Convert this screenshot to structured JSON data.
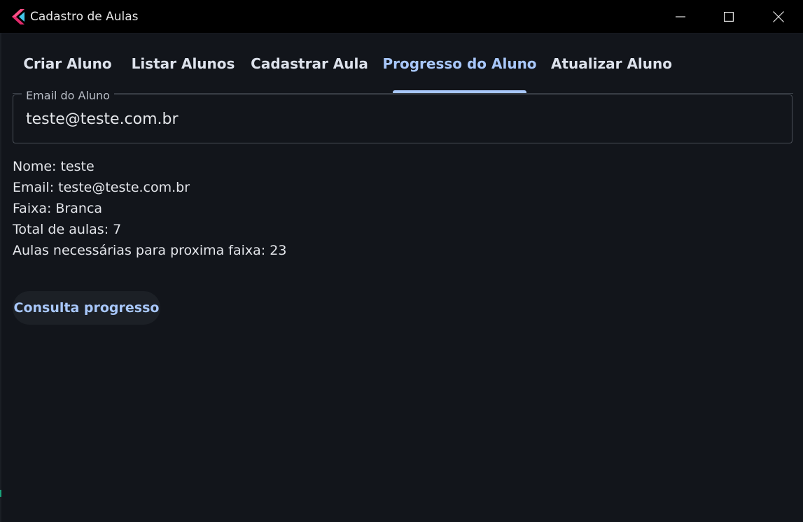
{
  "window": {
    "title": "Cadastro de Aulas",
    "app_icon": "flutter-icon",
    "controls": [
      "minimize-icon",
      "maximize-icon",
      "close-icon"
    ]
  },
  "tabs": [
    {
      "label": "Criar Aluno",
      "active": false
    },
    {
      "label": "Listar Alunos",
      "active": false
    },
    {
      "label": "Cadastrar Aula",
      "active": false
    },
    {
      "label": "Progresso do Aluno",
      "active": true
    },
    {
      "label": "Atualizar Aluno",
      "active": false
    }
  ],
  "email_field": {
    "label": "Email do Aluno",
    "value": "teste@teste.com.br"
  },
  "student_info": {
    "nome": "Nome: teste",
    "email": "Email: teste@teste.com.br",
    "faixa": "Faixa: Branca",
    "total_aulas": "Total de aulas: 7",
    "aulas_necessarias": "Aulas necessárias para proxima faixa: 23"
  },
  "actions": {
    "consult_label": "Consulta progresso"
  },
  "colors": {
    "accent": "#a8c7fa",
    "background": "#12151b",
    "titlebar": "#000000",
    "text": "#e3e5ea"
  }
}
